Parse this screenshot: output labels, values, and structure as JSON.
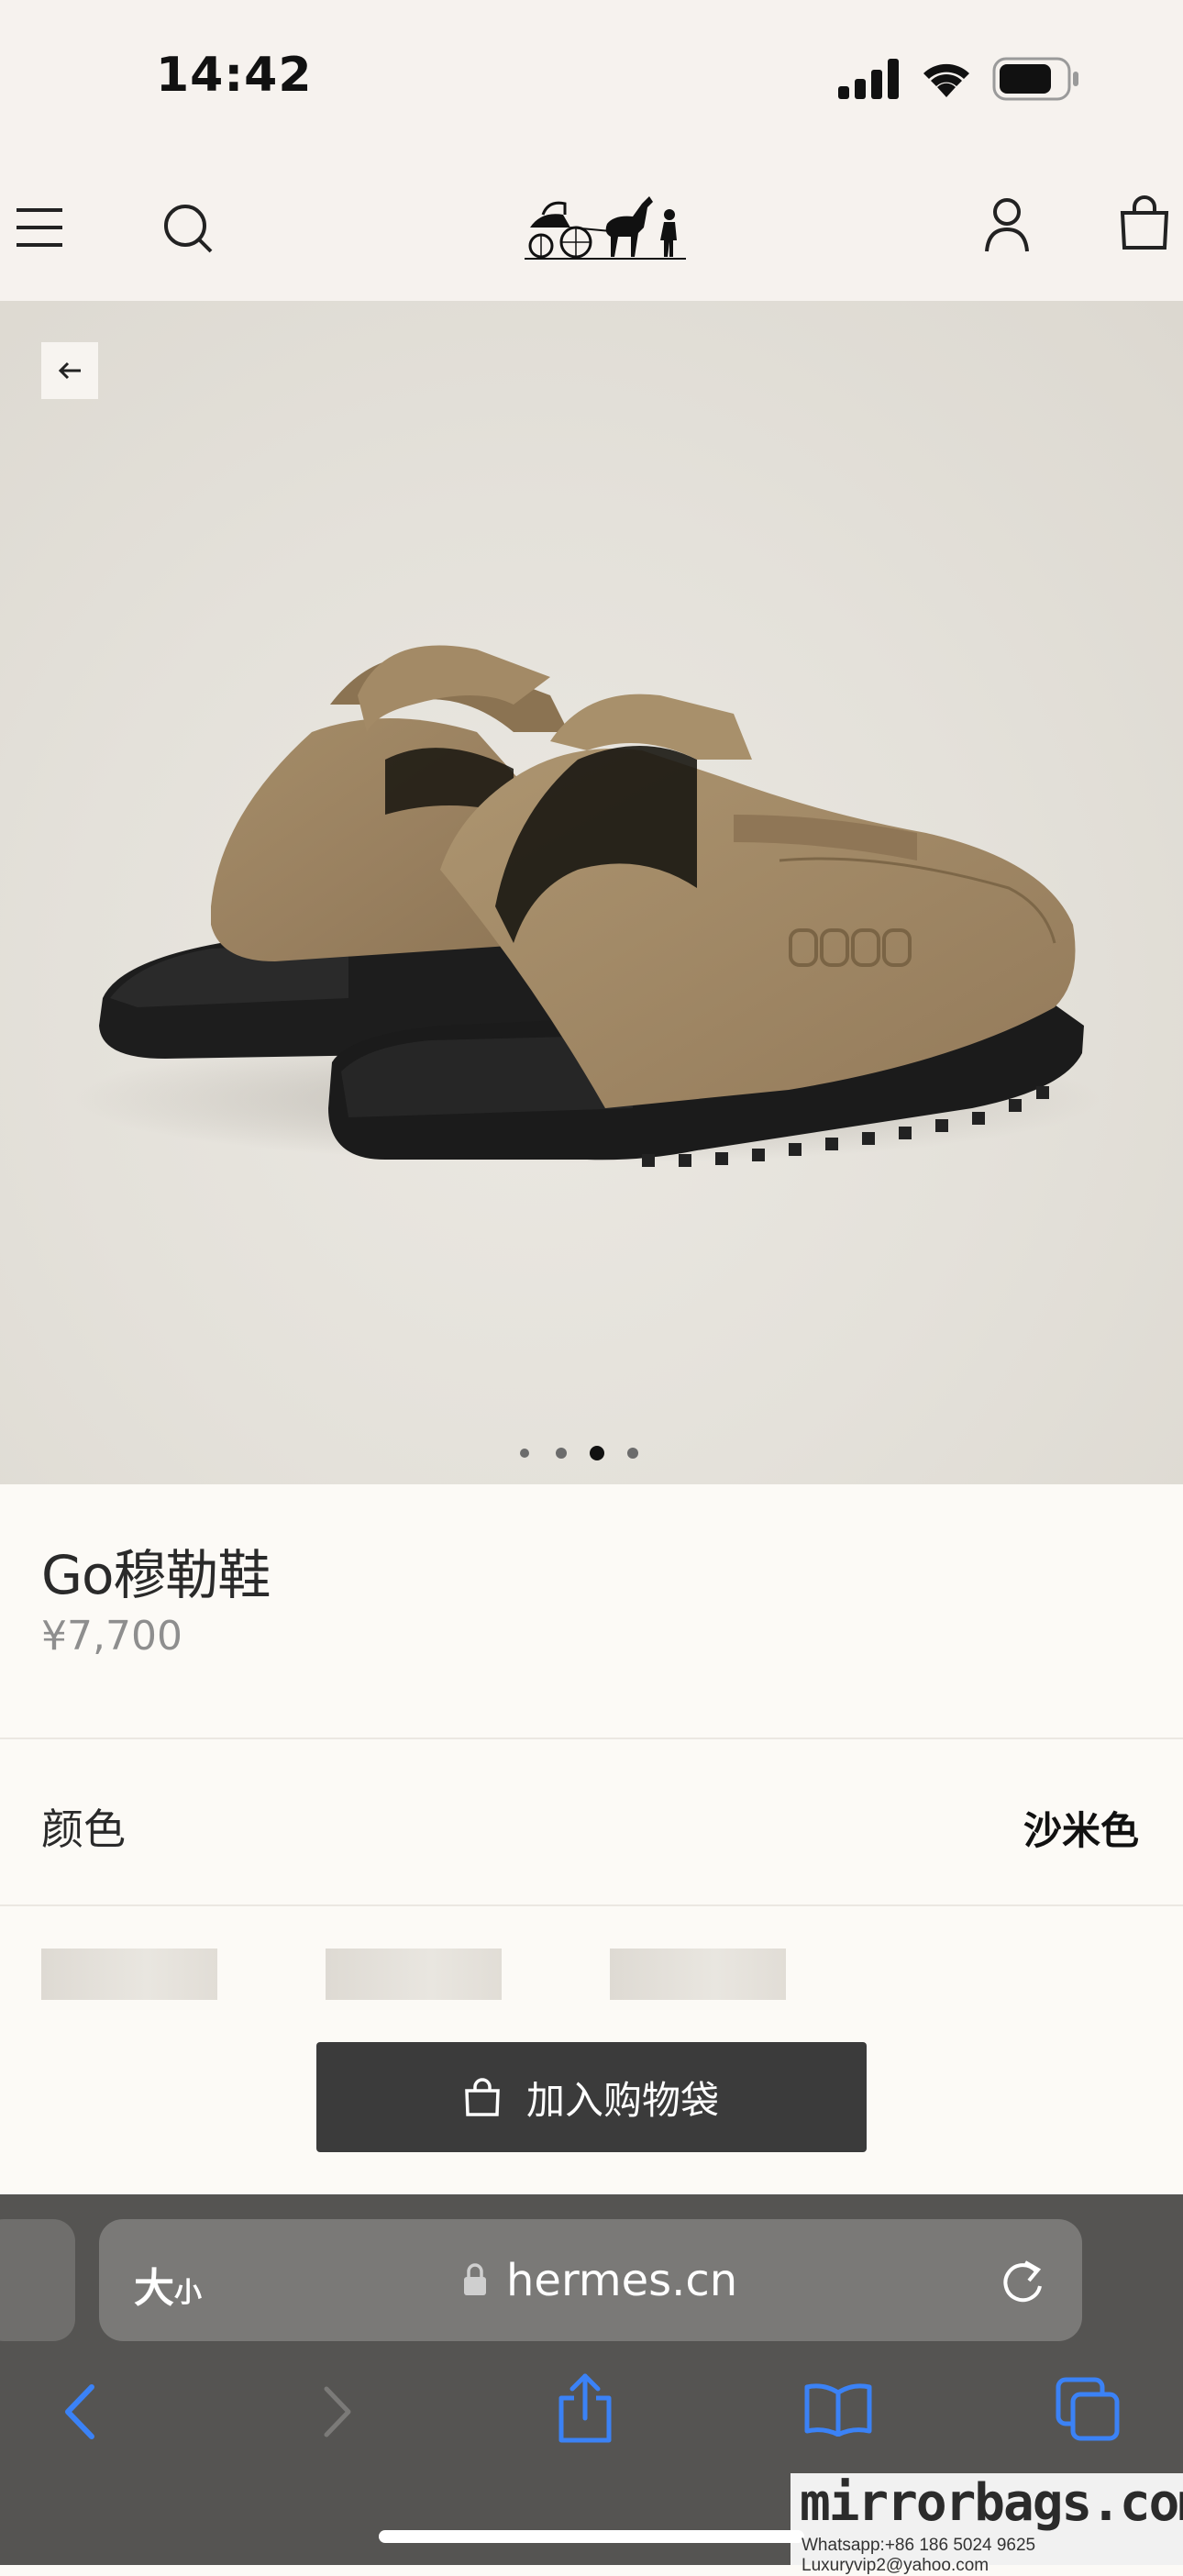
{
  "status_bar": {
    "time": "14:42"
  },
  "header": {
    "icons": [
      "menu-icon",
      "search-icon",
      "hermes-carriage-logo",
      "account-icon",
      "shopping-bag-icon"
    ]
  },
  "hero": {
    "image": "suede-mule-product-photo",
    "carousel": {
      "total": 4,
      "active_index": 2
    }
  },
  "product": {
    "title": "Go穆勒鞋",
    "price": "¥7,700"
  },
  "color": {
    "label": "颜色",
    "value": "沙米色",
    "swatch_count": 3
  },
  "cta": {
    "add_to_bag_label": "加入购物袋"
  },
  "safari": {
    "text_size_large": "大",
    "text_size_small": "小",
    "url": "hermes.cn",
    "toolbar_icons": [
      "back-icon",
      "forward-icon",
      "share-icon",
      "bookmarks-icon",
      "tabs-icon"
    ]
  },
  "watermark": {
    "title": "mirrorbags.com",
    "contact": "Whatsapp:+86 186 5024 9625   Luxuryvip2@yahoo.com"
  }
}
